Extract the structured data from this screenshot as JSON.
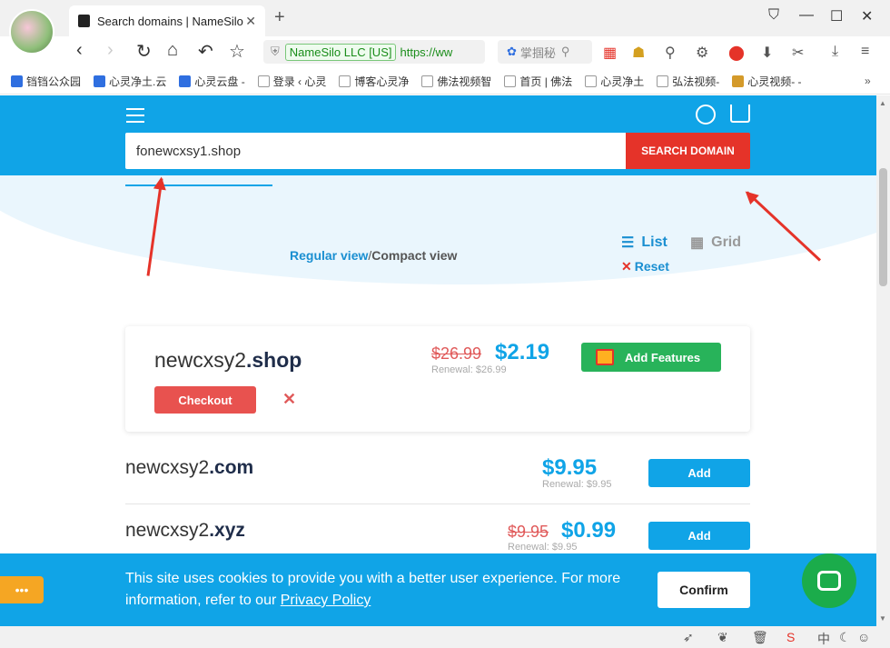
{
  "browser": {
    "tab_title": "Search domains | NameSilo",
    "tab_close": "✕",
    "new_tab": "+",
    "security_label": "NameSilo LLC [US]",
    "url": "https://ww",
    "search_box": "掌掴秘",
    "bookmarks": [
      "铛铛公众园",
      "心灵净土.云",
      "心灵云盘 -",
      "登录 ‹ 心灵",
      "博客心灵净",
      "佛法视频智",
      "首页 | 佛法",
      "心灵净土",
      "弘法视频-",
      "心灵视频- -"
    ]
  },
  "header": {
    "search_value": "fonewcxsy1.shop",
    "search_button": "SEARCH DOMAIN"
  },
  "views": {
    "regular": "Regular view",
    "separator": "/",
    "compact": "Compact view",
    "list": "List",
    "grid": "Grid",
    "reset": "Reset"
  },
  "selected": {
    "name": "newcxsy2",
    "tld": ".shop",
    "old_price": "$26.99",
    "price": "$2.19",
    "renewal": "Renewal: $26.99",
    "checkout": "Checkout",
    "features": "Add Features"
  },
  "results": [
    {
      "name": "newcxsy2",
      "tld": ".com",
      "old_price": "",
      "price": "$9.95",
      "renewal": "Renewal: $9.95",
      "button": "Add"
    },
    {
      "name": "newcxsy2",
      "tld": ".xyz",
      "old_price": "$9.95",
      "price": "$0.99",
      "renewal": "Renewal: $9.95",
      "button": "Add"
    }
  ],
  "cookie": {
    "text": "This site uses cookies to provide you with a better user experience. For more information, refer to our",
    "link": "Privacy Policy",
    "confirm": "Confirm"
  },
  "colors": {
    "brand_blue": "#10a4e7",
    "search_red": "#e53329",
    "features_green": "#28b35a",
    "chat_green": "#1bac4b"
  }
}
